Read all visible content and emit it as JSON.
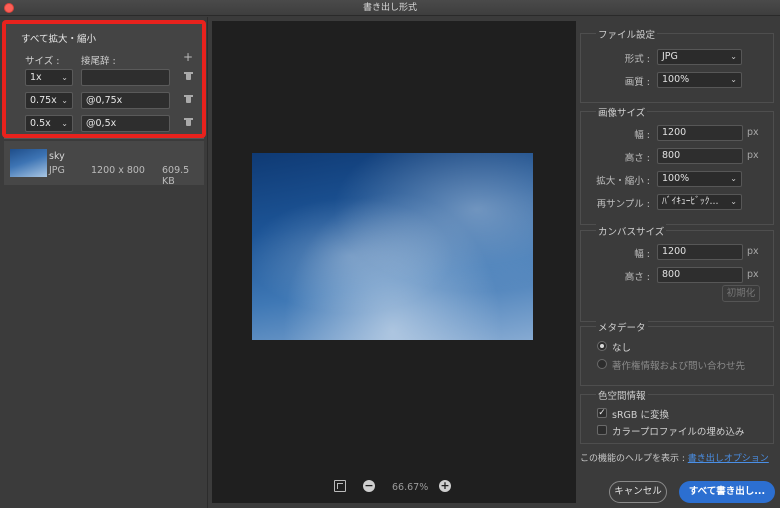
{
  "window": {
    "title": "書き出し形式"
  },
  "scale_panel": {
    "title": "すべて拡大・縮小",
    "col_size": "サイズ :",
    "col_suffix": "接尾辞 :",
    "add_label": "+",
    "rows": [
      {
        "size": "1x",
        "suffix": ""
      },
      {
        "size": "0.75x",
        "suffix": "@0,75x"
      },
      {
        "size": "0.5x",
        "suffix": "@0,5x"
      }
    ]
  },
  "asset": {
    "name": "sky",
    "type": "JPG",
    "dimensions": "1200 x 800",
    "size": "609.5 KB"
  },
  "preview": {
    "zoom": "66.67%"
  },
  "file_settings": {
    "title": "ファイル設定",
    "format_label": "形式 :",
    "format_value": "JPG",
    "quality_label": "画質 :",
    "quality_value": "100%"
  },
  "image_size": {
    "title": "画像サイズ",
    "width_label": "幅 :",
    "width_value": "1200",
    "height_label": "高さ :",
    "height_value": "800",
    "unit": "px",
    "scale_label": "拡大・縮小 :",
    "scale_value": "100%",
    "resample_label": "再サンプル :",
    "resample_value": "ﾊﾞｲｷｭｰﾋﾞｯｸ..."
  },
  "canvas_size": {
    "title": "カンバスサイズ",
    "width_label": "幅 :",
    "width_value": "1200",
    "height_label": "高さ :",
    "height_value": "800",
    "unit": "px",
    "reset_label": "初期化"
  },
  "metadata": {
    "title": "メタデータ",
    "option_none": "なし",
    "option_copyright": "著作権情報および問い合わせ先"
  },
  "color_space": {
    "title": "色空間情報",
    "srgb_label": "sRGB に変換",
    "embed_label": "カラープロファイルの埋め込み"
  },
  "help": {
    "text": "この機能のヘルプを表示 : ",
    "link": "書き出しオプション"
  },
  "buttons": {
    "cancel": "キャンセル",
    "export": "すべて書き出し..."
  },
  "colors": {
    "accent": "#2c6fd1",
    "highlight": "#e8221d",
    "link": "#4a8fe6"
  }
}
